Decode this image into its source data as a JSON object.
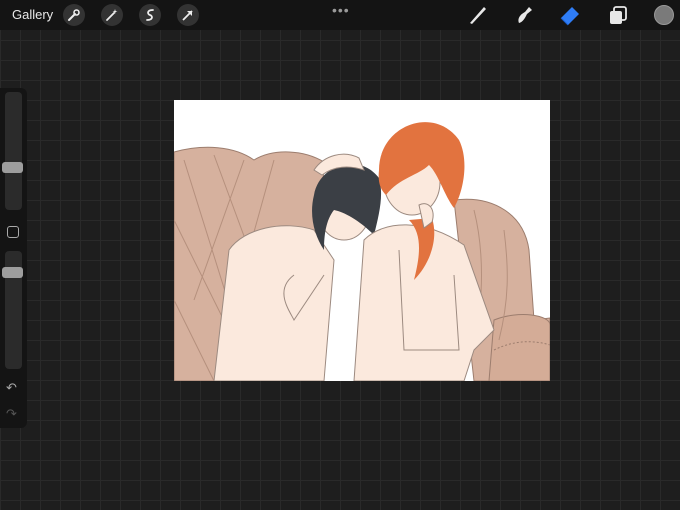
{
  "topbar": {
    "gallery_label": "Gallery",
    "left_tools": [
      "wrench-icon",
      "magic-wand-icon",
      "selection-icon",
      "transform-arrow-icon"
    ],
    "more_dots": "•••",
    "right_tools": [
      "brush-icon",
      "smudge-icon",
      "eraser-icon",
      "layers-icon",
      "color-swatch"
    ],
    "active_tool": "eraser",
    "colors": {
      "active_tool": "#2f7df6",
      "current_color": "#7a7a7a"
    }
  },
  "sidebar": {
    "brush_size_level": 0.35,
    "opacity_level": 0.85,
    "undo_icon": "↶",
    "redo_icon": "↷"
  },
  "canvas": {
    "artwork": "digital-illustration"
  }
}
